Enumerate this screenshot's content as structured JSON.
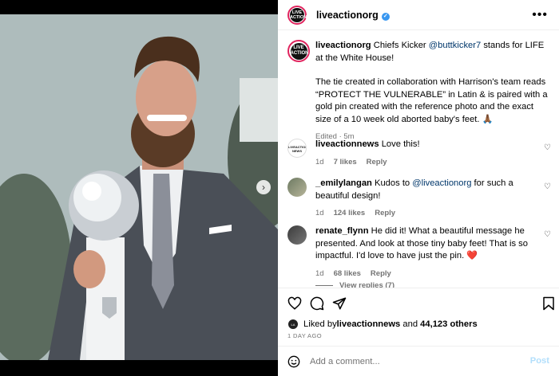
{
  "header": {
    "username": "liveactionorg",
    "avatar_text": "LIVE ACTION"
  },
  "caption": {
    "username": "liveactionorg",
    "text_1": " Chiefs Kicker ",
    "mention_1": "@buttkicker7",
    "text_2": " stands for LIFE at the White House!",
    "paragraph_2": "The tie created in collaboration with Harrison's team reads “PROTECT THE VULNERABLE” in Latin & is paired with a gold pin created with the reference photo and the exact size of a 10 week old aborted baby's feet. 🙏🏾",
    "meta": "Edited · 5m"
  },
  "comments": [
    {
      "username": "liveactionnews",
      "text": " Love this!",
      "time": "1d",
      "likes": "7 likes",
      "reply": "Reply",
      "avatar_text": "LIVEACTION NEWS"
    },
    {
      "username": "_emilylangan",
      "text_1": " Kudos to ",
      "mention": "@liveactionorg",
      "text_2": " for such a beautiful design!",
      "time": "1d",
      "likes": "124 likes",
      "reply": "Reply"
    },
    {
      "username": "renate_flynn",
      "text": " He did it! What a beautiful message he presented. And look at those tiny baby feet! That is so impactful. I'd love to have just the pin. ❤️",
      "time": "1d",
      "likes": "68 likes",
      "reply": "Reply"
    }
  ],
  "view_replies": "View replies (7)",
  "likes": {
    "prefix": "Liked by ",
    "user": "liveactionnews",
    "middle": " and ",
    "count": "44,123 others"
  },
  "date": "1 DAY AGO",
  "add_comment": {
    "placeholder": "Add a comment...",
    "post_label": "Post"
  },
  "icons": {
    "heart": "heart-icon",
    "comment": "comment-icon",
    "share": "share-icon",
    "save": "bookmark-icon",
    "emoji": "emoji-icon",
    "more": "more-options-icon",
    "verified": "verified-badge-icon",
    "next": "chevron-right-icon"
  },
  "colors": {
    "verified": "#3897f0",
    "mention": "#00376b",
    "muted": "#737373",
    "post_disabled": "#b2dffc",
    "avatar_ring": "#e0245e"
  }
}
